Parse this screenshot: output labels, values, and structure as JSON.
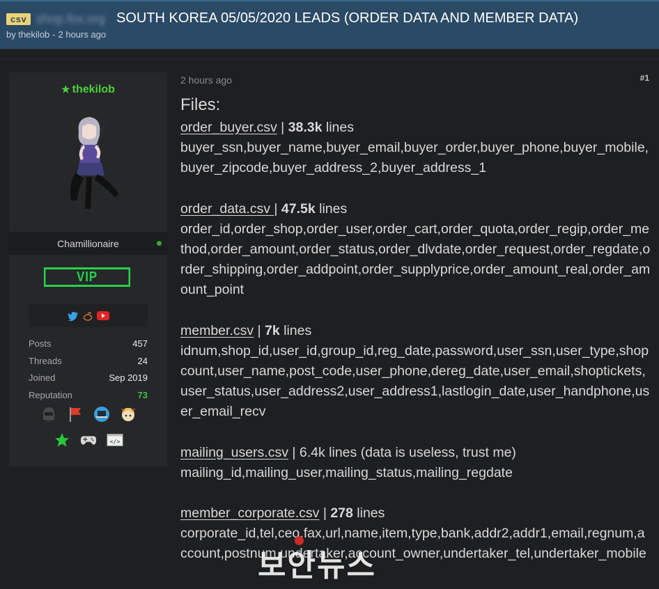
{
  "header": {
    "prefix": "csv",
    "blurred_site": "shop.fox.org",
    "title": "SOUTH KOREA 05/05/2020 LEADS (ORDER DATA AND MEMBER DATA)",
    "author": "by thekilob",
    "time": "2 hours ago"
  },
  "user": {
    "name": "thekilob",
    "title": "Chamillionaire",
    "badge": "VIP",
    "stats": [
      {
        "label": "Posts",
        "value": "457"
      },
      {
        "label": "Threads",
        "value": "24"
      },
      {
        "label": "Joined",
        "value": "Sep 2019"
      },
      {
        "label": "Reputation",
        "value": "73"
      }
    ]
  },
  "post": {
    "time": "2 hours ago",
    "number": "#1",
    "heading": "Files:",
    "files": [
      {
        "name": "order_buyer.csv",
        "sep": " | ",
        "count": "38.3k",
        "suffix": " lines",
        "columns": "buyer_ssn,buyer_name,buyer_email,buyer_order,buyer_phone,buyer_mobile,buyer_zipcode,buyer_address_2,buyer_address_1"
      },
      {
        "name": "order_data.csv ",
        "sep": "| ",
        "count": "47.5k",
        "suffix": " lines",
        "columns": "order_id,order_shop,order_user,order_cart,order_quota,order_regip,order_method,order_amount,order_status,order_dlvdate,order_request,order_regdate,order_shipping,order_addpoint,order_supplyprice,order_amount_real,order_amount_point"
      },
      {
        "name": "member.csv",
        "sep": " | ",
        "count": "7k",
        "suffix": " lines",
        "columns": "idnum,shop_id,user_id,group_id,reg_date,password,user_ssn,user_type,shopcount,user_name,post_code,user_phone,dereg_date,user_email,shoptickets,user_status,user_address2,user_address1,lastlogin_date,user_handphone,user_email_recv"
      },
      {
        "name": "mailing_users.csv",
        "sep": " | ",
        "count": "",
        "suffix": "6.4k lines (data is useless, trust me)",
        "columns": "mailing_id,mailing_user,mailing_status,mailing_regdate"
      },
      {
        "name": "member_corporate.csv",
        "sep": " | ",
        "count": "278",
        "suffix": " lines",
        "columns": "corporate_id,tel,ceo,fax,url,name,item,type,bank,addr2,addr1,email,regnum,account,postnum,undertaker,account_owner,undertaker_tel,undertaker_mobile"
      }
    ]
  },
  "watermark": "보안뉴스",
  "colors": {
    "accent_green": "#27d14a",
    "header_blue": "#2b4a66",
    "background": "#1e1f21"
  },
  "icons": [
    "star-icon",
    "twitter-icon",
    "reddit-icon",
    "youtube-icon",
    "online-status-icon",
    "helmet-award-icon",
    "flag-award-icon",
    "laptop-award-icon",
    "anime-award-icon",
    "green-star-award-icon",
    "gamepad-award-icon",
    "code-award-icon"
  ]
}
